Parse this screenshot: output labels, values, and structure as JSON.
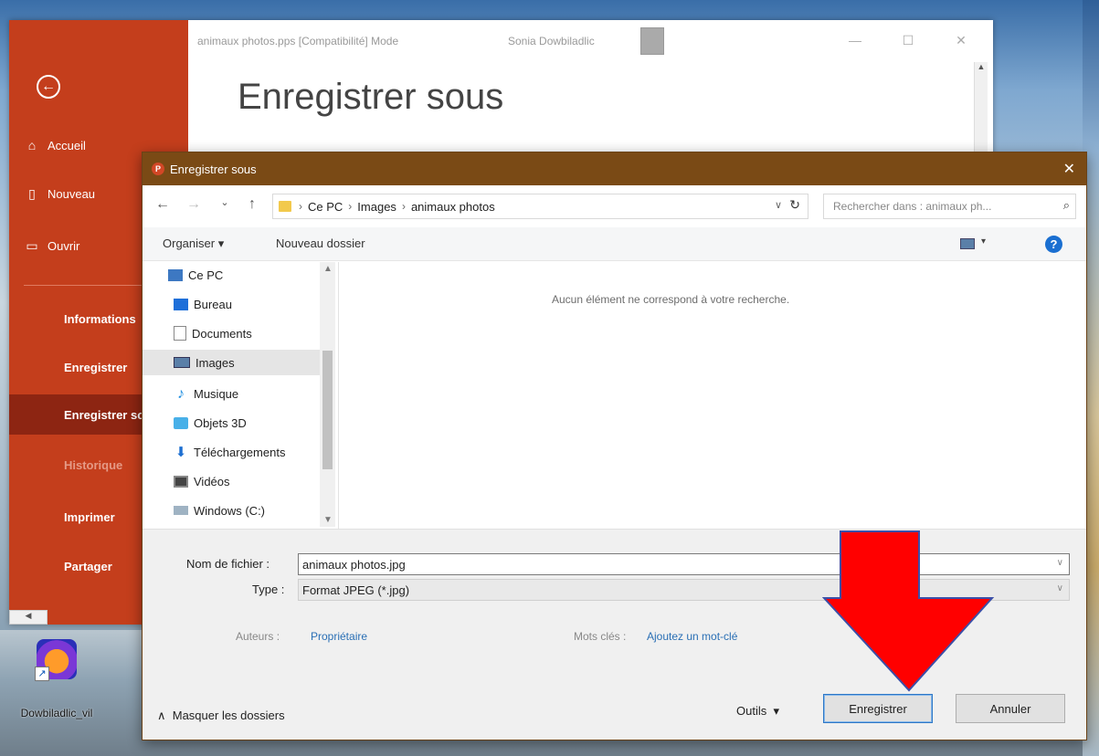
{
  "desktop": {
    "shortcut_label": "Dowbiladlic_vil"
  },
  "ppt": {
    "window_title": "animaux photos.pps [Compatibilité] Mode",
    "user_name": "Sonia Dowbiladlic",
    "heading": "Enregistrer sous",
    "sidebar": [
      {
        "label": "Accueil",
        "icon": "home-icon"
      },
      {
        "label": "Nouveau",
        "icon": "new-doc-icon"
      },
      {
        "label": "Ouvrir",
        "icon": "folder-open-icon"
      },
      {
        "label": "Informations"
      },
      {
        "label": "Enregistrer"
      },
      {
        "label": "Enregistrer sous"
      },
      {
        "label": "Historique"
      },
      {
        "label": "Imprimer"
      },
      {
        "label": "Partager"
      }
    ]
  },
  "dialog": {
    "title": "Enregistrer sous",
    "breadcrumb": [
      "Ce PC",
      "Images",
      "animaux photos"
    ],
    "search_placeholder": "Rechercher dans : animaux ph...",
    "toolbar": {
      "organize": "Organiser",
      "new_folder": "Nouveau dossier"
    },
    "tree": [
      "Ce PC",
      "Bureau",
      "Documents",
      "Images",
      "Musique",
      "Objets 3D",
      "Téléchargements",
      "Vidéos",
      "Windows (C:)"
    ],
    "empty_message": "Aucun élément ne correspond à votre recherche.",
    "filename_label": "Nom de fichier :",
    "filename_value": "animaux photos.jpg",
    "type_label": "Type :",
    "type_value": "Format JPEG (*.jpg)",
    "authors_label": "Auteurs :",
    "authors_value": "Propriétaire",
    "tags_label": "Mots clés :",
    "tags_value": "Ajoutez un mot-clé",
    "hide_folders": "Masquer les dossiers",
    "tools": "Outils",
    "save_button": "Enregistrer",
    "cancel_button": "Annuler"
  },
  "colors": {
    "ppt_accent": "#c43e1c",
    "dialog_titlebar": "#7a4a15",
    "annotation_arrow": "#ff0000"
  }
}
